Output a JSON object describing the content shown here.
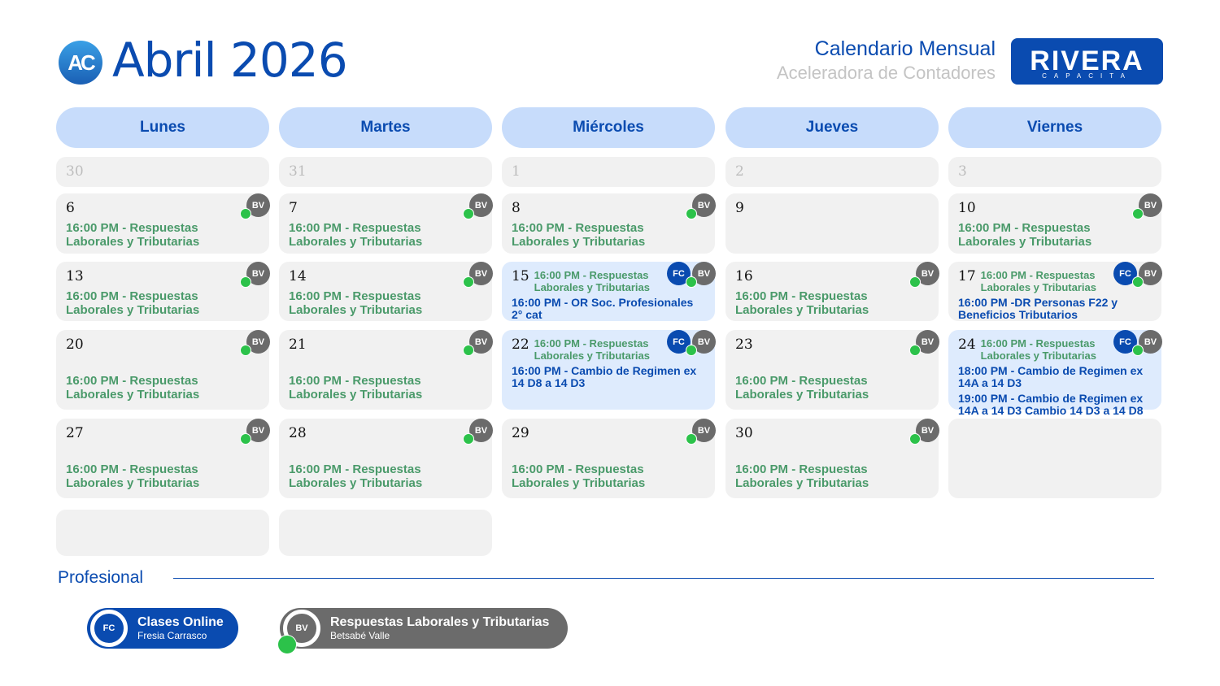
{
  "header": {
    "logo_text": "AC",
    "title": "Abril 2026",
    "subtitle": "Calendario Mensual",
    "tagline": "Aceleradora de Contadores",
    "brand_name": "RIVERA",
    "brand_sub": "CAPACITA"
  },
  "weekdays": [
    "Lunes",
    "Martes",
    "Miércoles",
    "Jueves",
    "Viernes"
  ],
  "weeks": [
    [
      {
        "num": "30",
        "muted": true
      },
      {
        "num": "31",
        "muted": true
      },
      {
        "num": "1",
        "muted": true
      },
      {
        "num": "2",
        "muted": true
      },
      {
        "num": "3",
        "muted": true
      }
    ],
    [
      {
        "num": "6",
        "badges": [
          "BV"
        ],
        "events": [
          {
            "text": "16:00 PM - Respuestas Laborales y Tributarias",
            "color": "green"
          }
        ]
      },
      {
        "num": "7",
        "badges": [
          "BV"
        ],
        "events": [
          {
            "text": "16:00 PM - Respuestas Laborales y Tributarias",
            "color": "green"
          }
        ]
      },
      {
        "num": "8",
        "badges": [
          "BV"
        ],
        "events": [
          {
            "text": "16:00 PM - Respuestas Laborales y Tributarias",
            "color": "green"
          }
        ]
      },
      {
        "num": "9"
      },
      {
        "num": "10",
        "badges": [
          "BV"
        ],
        "events": [
          {
            "text": "16:00 PM - Respuestas Laborales y Tributarias",
            "color": "green"
          }
        ]
      }
    ],
    [
      {
        "num": "13",
        "badges": [
          "BV"
        ],
        "events": [
          {
            "text": "16:00 PM - Respuestas Laborales y Tributarias",
            "color": "green"
          }
        ]
      },
      {
        "num": "14",
        "badges": [
          "BV"
        ],
        "events": [
          {
            "text": "16:00 PM - Respuestas Laborales y Tributarias",
            "color": "green"
          }
        ]
      },
      {
        "num": "15",
        "highlight": true,
        "compact": true,
        "badges": [
          "FC",
          "BV"
        ],
        "events": [
          {
            "text": "16:00 PM - Respuestas Laborales y Tributarias",
            "color": "green"
          },
          {
            "text": "16:00 PM - OR Soc. Profesionales 2° cat",
            "color": "blue"
          }
        ]
      },
      {
        "num": "16",
        "badges": [
          "BV"
        ],
        "events": [
          {
            "text": "16:00 PM - Respuestas Laborales y Tributarias",
            "color": "green"
          }
        ]
      },
      {
        "num": "17",
        "compact": true,
        "badges": [
          "FC",
          "BV"
        ],
        "events": [
          {
            "text": "16:00 PM - Respuestas Laborales y Tributarias",
            "color": "green"
          },
          {
            "text": "16:00 PM -DR Personas F22 y Beneficios Tributarios",
            "color": "blue"
          }
        ]
      }
    ],
    [
      {
        "num": "20",
        "badges": [
          "BV"
        ],
        "events": [
          {
            "text": "16:00 PM - Respuestas Laborales y Tributarias",
            "color": "green"
          }
        ]
      },
      {
        "num": "21",
        "badges": [
          "BV"
        ],
        "events": [
          {
            "text": "16:00 PM - Respuestas Laborales y Tributarias",
            "color": "green"
          }
        ]
      },
      {
        "num": "22",
        "highlight": true,
        "compact": true,
        "badges": [
          "FC",
          "BV"
        ],
        "events": [
          {
            "text": "16:00 PM - Respuestas Laborales y Tributarias",
            "color": "green"
          },
          {
            "text": "16:00 PM - Cambio de Regimen ex 14 D8 a 14 D3",
            "color": "blue"
          }
        ]
      },
      {
        "num": "23",
        "badges": [
          "BV"
        ],
        "events": [
          {
            "text": "16:00 PM - Respuestas Laborales y Tributarias",
            "color": "green"
          }
        ]
      },
      {
        "num": "24",
        "highlight": true,
        "compact": true,
        "badges": [
          "FC",
          "BV"
        ],
        "events": [
          {
            "text": "16:00 PM - Respuestas Laborales y Tributarias",
            "color": "green"
          },
          {
            "text": "18:00 PM - Cambio de Regimen ex 14A a 14 D3",
            "color": "blue"
          },
          {
            "text": "19:00 PM - Cambio de Regimen ex 14A a 14 D3  Cambio  14 D3 a 14 D8",
            "color": "blue"
          }
        ]
      }
    ],
    [
      {
        "num": "27",
        "badges": [
          "BV"
        ],
        "events": [
          {
            "text": "16:00 PM - Respuestas Laborales y Tributarias",
            "color": "green"
          }
        ]
      },
      {
        "num": "28",
        "badges": [
          "BV"
        ],
        "events": [
          {
            "text": "16:00 PM - Respuestas Laborales y Tributarias",
            "color": "green"
          }
        ]
      },
      {
        "num": "29",
        "badges": [
          "BV"
        ],
        "events": [
          {
            "text": "16:00 PM - Respuestas Laborales y Tributarias",
            "color": "green"
          }
        ]
      },
      {
        "num": "30",
        "badges": [
          "BV"
        ],
        "events": [
          {
            "text": "16:00 PM - Respuestas Laborales y Tributarias",
            "color": "green"
          }
        ]
      },
      {
        "num": ""
      }
    ],
    [
      {
        "num": ""
      },
      {
        "num": ""
      }
    ]
  ],
  "legend": {
    "section": "Profesional",
    "items": [
      {
        "initials": "FC",
        "title": "Clases Online",
        "person": "Fresia Carrasco",
        "color": "#0a4bb0"
      },
      {
        "initials": "BV",
        "title": "Respuestas Laborales y Tributarias",
        "person": "Betsabé Valle",
        "color": "#6b6b6b"
      }
    ]
  }
}
